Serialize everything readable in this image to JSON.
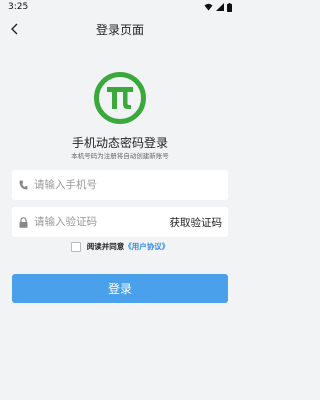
{
  "status_bar": {
    "time": "3:25",
    "icons": [
      "wifi-icon",
      "signal-icon",
      "battery-icon"
    ]
  },
  "nav": {
    "back_icon": "chevron-left-icon",
    "title": "登录页面"
  },
  "logo": {
    "icon": "app-logo-icon",
    "color": "#3ba83b"
  },
  "header": {
    "title": "手机动态密码登录",
    "subtitle": "本机号码为注册将自动创建新账号"
  },
  "form": {
    "phone": {
      "icon": "phone-icon",
      "value": "",
      "placeholder": "请输入手机号"
    },
    "code": {
      "icon": "lock-icon",
      "value": "",
      "placeholder": "请输入验证码",
      "get_code_label": "获取验证码"
    },
    "agreement": {
      "checked": false,
      "text": "阅读并同意",
      "link_text": "《用户协议》"
    },
    "submit_label": "登录"
  },
  "colors": {
    "background": "#f2f3f5",
    "primary_button": "#4aa0ea",
    "link": "#3a8ee6"
  }
}
